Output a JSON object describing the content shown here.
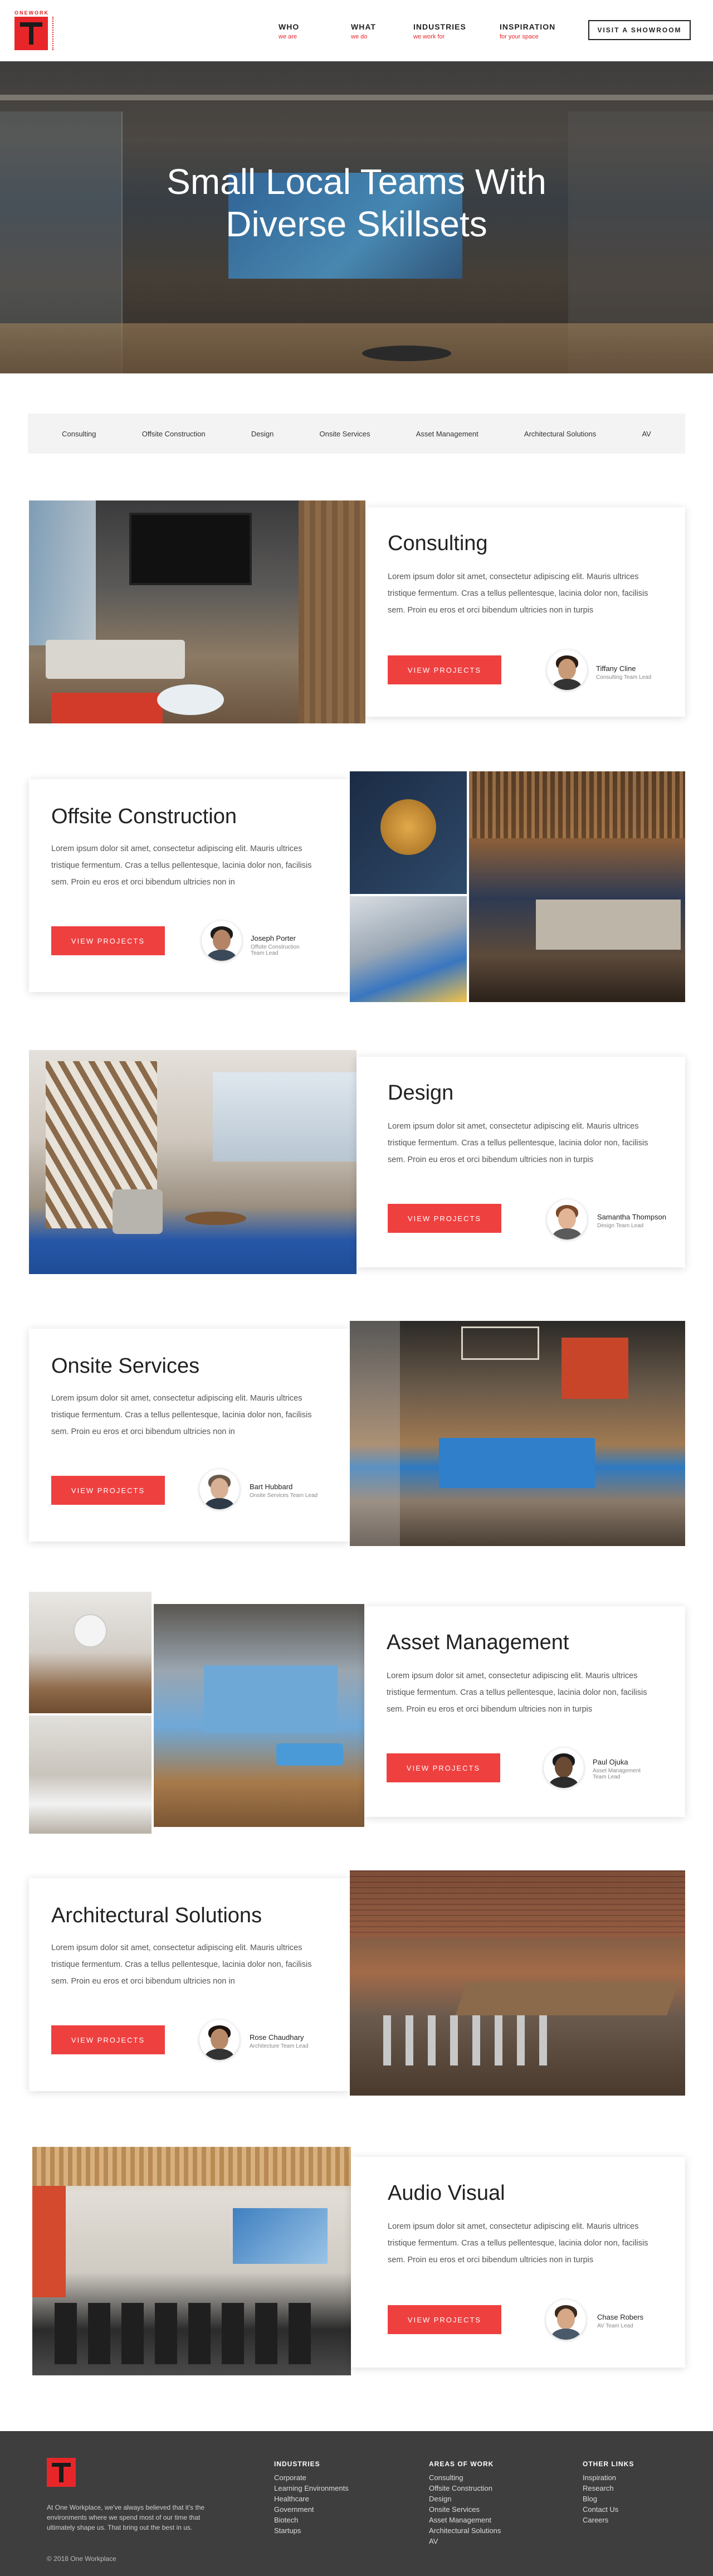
{
  "header": {
    "brand_small": "ONEWORK",
    "nav": [
      {
        "label": "WHO",
        "sub": "we are"
      },
      {
        "label": "WHAT",
        "sub": "we do"
      },
      {
        "label": "INDUSTRIES",
        "sub": "we work for"
      },
      {
        "label": "INSPIRATION",
        "sub": "for your space"
      }
    ],
    "cta": "VISIT A SHOWROOM"
  },
  "hero": {
    "title_line1": "Small Local Teams With",
    "title_line2": "Diverse Skillsets"
  },
  "tabs": [
    "Consulting",
    "Offsite Construction",
    "Design",
    "Onsite Services",
    "Asset Management",
    "Architectural Solutions",
    "AV"
  ],
  "sections": [
    {
      "title": "Consulting",
      "body": "Lorem ipsum dolor sit amet, consectetur adipiscing elit. Mauris ultrices tristique fermentum. Cras a tellus pellentesque, lacinia dolor non, facilisis sem. Proin eu eros et orci bibendum ultricies non in turpis",
      "button": "VIEW PROJECTS",
      "lead_name": "Tiffany Cline",
      "lead_role": "Consulting Team Lead"
    },
    {
      "title": "Offsite Construction",
      "body": "Lorem ipsum dolor sit amet, consectetur adipiscing elit. Mauris ultrices tristique fermentum. Cras a tellus pellentesque, lacinia dolor non, facilisis sem. Proin eu eros et orci bibendum ultricies non in",
      "button": "VIEW PROJECTS",
      "lead_name": "Joseph Porter",
      "lead_role": "Offsite Construction Team Lead"
    },
    {
      "title": "Design",
      "body": "Lorem ipsum dolor sit amet, consectetur adipiscing elit. Mauris ultrices tristique fermentum. Cras a tellus pellentesque, lacinia dolor non, facilisis sem. Proin eu eros et orci bibendum ultricies non in turpis",
      "button": "VIEW PROJECTS",
      "lead_name": "Samantha Thompson",
      "lead_role": "Design Team Lead"
    },
    {
      "title": "Onsite Services",
      "body": "Lorem ipsum dolor sit amet, consectetur adipiscing elit. Mauris ultrices tristique fermentum. Cras a tellus pellentesque, lacinia dolor non, facilisis sem. Proin eu eros et orci bibendum ultricies non in",
      "button": "VIEW PROJECTS",
      "lead_name": "Bart Hubbard",
      "lead_role": "Onsite Services Team Lead"
    },
    {
      "title": "Asset Management",
      "body": "Lorem ipsum dolor sit amet, consectetur adipiscing elit. Mauris ultrices tristique fermentum. Cras a tellus pellentesque, lacinia dolor non, facilisis sem. Proin eu eros et orci bibendum ultricies non in turpis",
      "button": "VIEW PROJECTS",
      "lead_name": "Paul Ojuka",
      "lead_role": "Asset Management Team Lead"
    },
    {
      "title": "Architectural Solutions",
      "body": "Lorem ipsum dolor sit amet, consectetur adipiscing elit. Mauris ultrices tristique fermentum. Cras a tellus pellentesque, lacinia dolor non, facilisis sem. Proin eu eros et orci bibendum ultricies non in",
      "button": "VIEW PROJECTS",
      "lead_name": "Rose Chaudhary",
      "lead_role": "Architecture Team Lead"
    },
    {
      "title": "Audio Visual",
      "body": "Lorem ipsum dolor sit amet, consectetur adipiscing elit. Mauris ultrices tristique fermentum. Cras a tellus pellentesque, lacinia dolor non, facilisis sem. Proin eu eros et orci bibendum ultricies non in turpis",
      "button": "VIEW PROJECTS",
      "lead_name": "Chase Robers",
      "lead_role": "AV Team Lead"
    }
  ],
  "footer": {
    "about": "At One Workplace, we've always believed that it's the environments where we spend most of our time that ultimately shape us. That bring out the best in us.",
    "copyright": "© 2018 One Workplace",
    "industries": {
      "heading": "INDUSTRIES",
      "links": [
        "Corporate",
        "Learning Environments",
        "Healthcare",
        "Government",
        "Biotech",
        "Startups"
      ]
    },
    "areas": {
      "heading": "AREAS OF WORK",
      "links": [
        "Consulting",
        "Offsite Construction",
        "Design",
        "Onsite Services",
        "Asset Management",
        "Architectural Solutions",
        "AV"
      ]
    },
    "other": {
      "heading": "OTHER LINKS",
      "links": [
        "Inspiration",
        "Research",
        "Blog",
        "Contact Us",
        "Careers"
      ]
    }
  },
  "colors": {
    "accent": "#ef4040",
    "footer_bg": "#3e3e3e",
    "tabs_bg": "#f3f3f3"
  }
}
